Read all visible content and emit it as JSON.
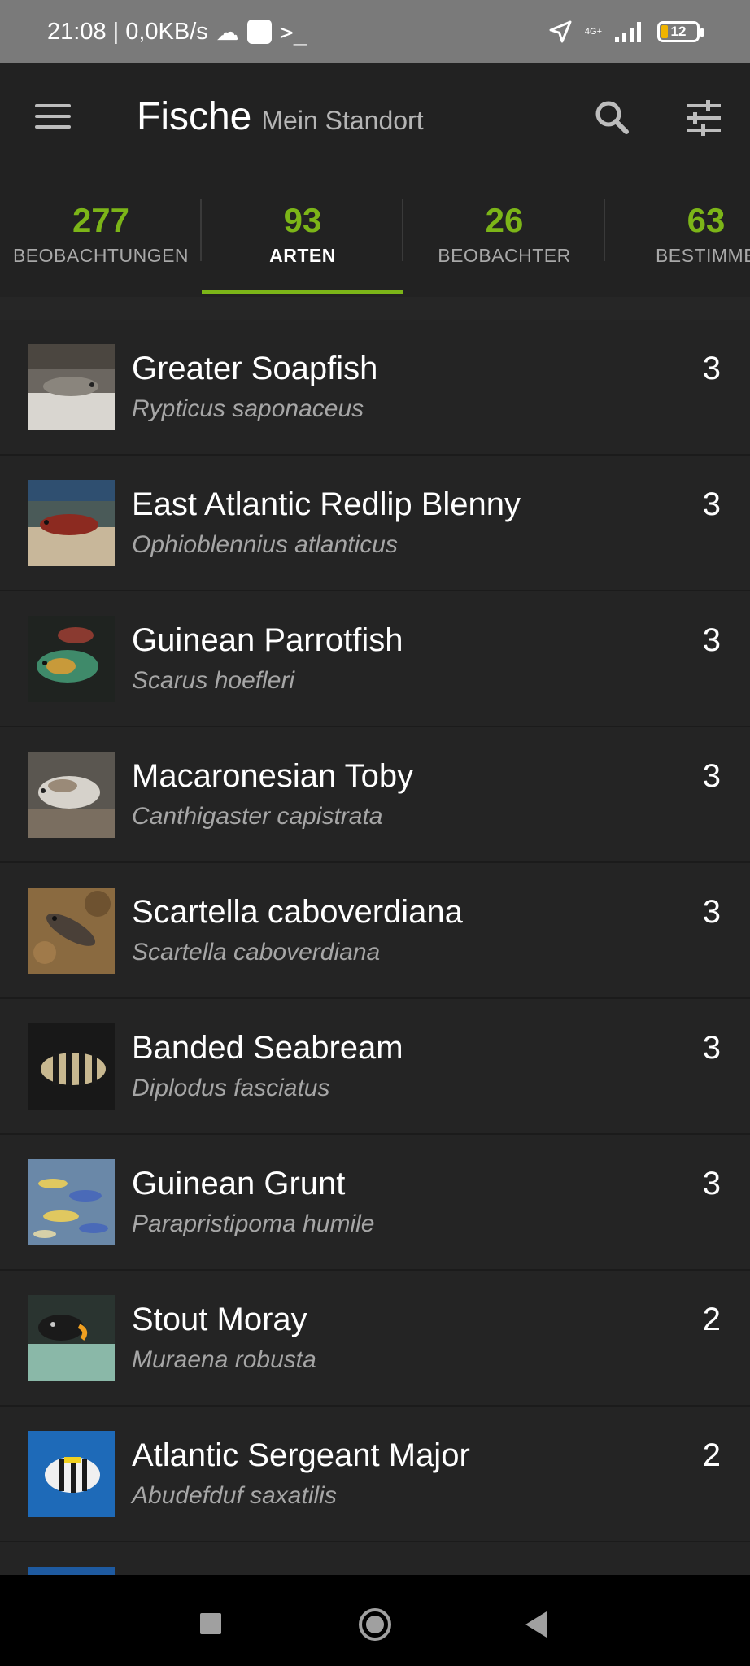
{
  "status_bar": {
    "time_speed": "21:08 | 0,0KB/s",
    "net_label": "4G+",
    "battery": "12",
    "icons": [
      "cloud-icon",
      "square-icon",
      "terminal-icon",
      "location-icon",
      "signal-icon",
      "battery-icon"
    ]
  },
  "app_bar": {
    "title": "Fische",
    "subtitle": "Mein Standort",
    "icons": [
      "menu-icon",
      "search-icon",
      "filter-icon"
    ]
  },
  "tabs": [
    {
      "count": "277",
      "label": "BEOBACHTUNGEN",
      "active": false
    },
    {
      "count": "93",
      "label": "ARTEN",
      "active": true
    },
    {
      "count": "26",
      "label": "BEOBACHTER",
      "active": false
    },
    {
      "count": "63",
      "label": "BESTIMME",
      "active": false
    }
  ],
  "colors": {
    "accent": "#7cb518",
    "background": "#222222",
    "status_bar": "#7a7a7a"
  },
  "species": [
    {
      "common": "Greater Soapfish",
      "scientific": "Rypticus saponaceus",
      "count": "3"
    },
    {
      "common": "East Atlantic Redlip Blenny",
      "scientific": "Ophioblennius atlanticus",
      "count": "3"
    },
    {
      "common": "Guinean Parrotfish",
      "scientific": "Scarus hoefleri",
      "count": "3"
    },
    {
      "common": "Macaronesian Toby",
      "scientific": "Canthigaster capistrata",
      "count": "3"
    },
    {
      "common": "Scartella caboverdiana",
      "scientific": "Scartella caboverdiana",
      "count": "3"
    },
    {
      "common": "Banded Seabream",
      "scientific": "Diplodus fasciatus",
      "count": "3"
    },
    {
      "common": "Guinean Grunt",
      "scientific": "Parapristipoma humile",
      "count": "3"
    },
    {
      "common": "Stout Moray",
      "scientific": "Muraena robusta",
      "count": "2"
    },
    {
      "common": "Atlantic Sergeant Major",
      "scientific": "Abudefduf saxatilis",
      "count": "2"
    }
  ]
}
